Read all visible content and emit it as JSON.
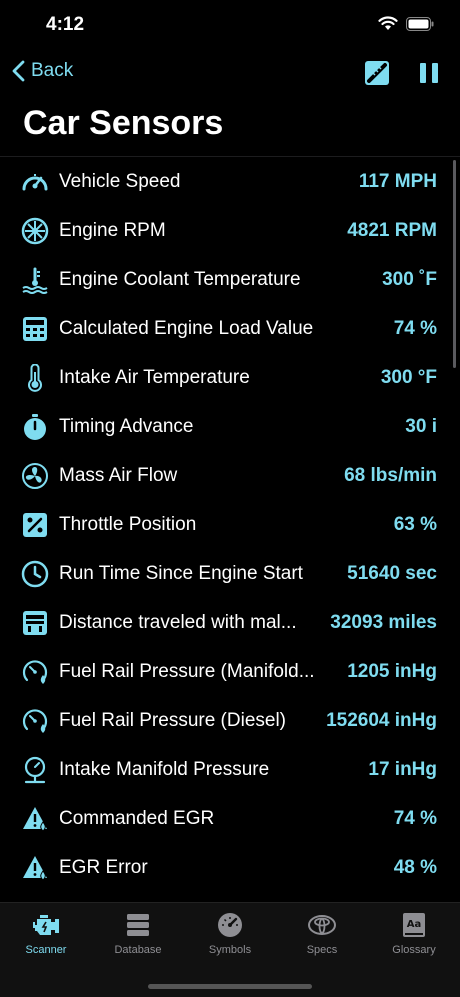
{
  "status_bar": {
    "time": "4:12"
  },
  "nav": {
    "back_label": "Back"
  },
  "page": {
    "title": "Car Sensors"
  },
  "colors": {
    "accent": "#7fdcf0",
    "background": "#000000",
    "tab_bar": "#111111"
  },
  "sensors": [
    {
      "icon": "speedometer-icon",
      "label": "Vehicle Speed",
      "value": "117 MPH"
    },
    {
      "icon": "turbine-icon",
      "label": "Engine RPM",
      "value": "4821 RPM"
    },
    {
      "icon": "coolant-temp-icon",
      "label": "Engine Coolant Temperature",
      "value": "300 ˚F"
    },
    {
      "icon": "calculator-icon",
      "label": "Calculated Engine Load Value",
      "value": "74 %"
    },
    {
      "icon": "thermometer-icon",
      "label": "Intake Air Temperature",
      "value": "300 °F"
    },
    {
      "icon": "stopwatch-icon",
      "label": "Timing Advance",
      "value": "30 i"
    },
    {
      "icon": "fan-icon",
      "label": "Mass Air Flow",
      "value": "68 lbs/min"
    },
    {
      "icon": "percent-icon",
      "label": "Throttle Position",
      "value": "63 %"
    },
    {
      "icon": "clock-icon",
      "label": "Run Time Since Engine Start",
      "value": "51640 sec"
    },
    {
      "icon": "dashboard-icon",
      "label": "Distance traveled with mal...",
      "value": "32093 miles"
    },
    {
      "icon": "fuel-gauge-icon",
      "label": "Fuel Rail Pressure (Manifold...",
      "value": "1205 inHg"
    },
    {
      "icon": "fuel-gauge-icon",
      "label": "Fuel Rail Pressure (Diesel)",
      "value": "152604 inHg"
    },
    {
      "icon": "pressure-gauge-icon",
      "label": "Intake Manifold Pressure",
      "value": "17 inHg"
    },
    {
      "icon": "warning-gauge-icon",
      "label": "Commanded EGR",
      "value": "74 %"
    },
    {
      "icon": "warning-gauge-icon",
      "label": "EGR Error",
      "value": "48 %"
    }
  ],
  "tabs": [
    {
      "label": "Scanner",
      "icon": "engine-icon",
      "active": true
    },
    {
      "label": "Database",
      "icon": "database-icon",
      "active": false
    },
    {
      "label": "Symbols",
      "icon": "gauge-icon",
      "active": false
    },
    {
      "label": "Specs",
      "icon": "toyota-logo-icon",
      "active": false
    },
    {
      "label": "Glossary",
      "icon": "dictionary-icon",
      "active": false
    }
  ]
}
